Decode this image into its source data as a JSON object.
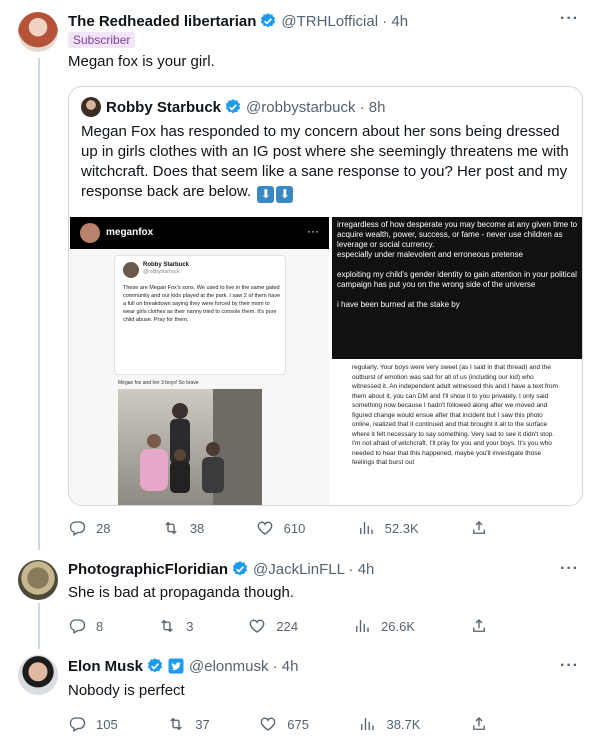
{
  "tweets": [
    {
      "name": "The Redheaded libertarian",
      "handle": "@TRHLofficial · 4h",
      "badge": "Subscriber",
      "text": "Megan fox is your girl.",
      "quote": {
        "name": "Robby Starbuck",
        "handle": "@robbystarbuck · 8h",
        "text": "Megan Fox has responded to my concern about her sons being dressed up in girls clothes with an IG post where she seemingly threatens me with witchcraft. Does that seem like a sane response to you? Her post and my response back are below.",
        "media": {
          "ig_name": "meganfox",
          "card_name": "Robby Starbuck",
          "card_handle": "@robbystarbuck",
          "card_text": "These are Megan Fox's sons. We used to live in the same gated community and our kids played at the park. I saw 2 of them have a full on breakdown saying they were forced by their mom to wear girls clothes as their nanny tried to console them. It's pure child abuse. Pray for them.",
          "caption": "Megan fox and her 3 boys! So brave",
          "dark_p1": "irregardless of how desperate you may become at any given time to acquire wealth, power, success, or fame - never use children as leverage or social currency.",
          "dark_p1b": "especially under malevolent and erroneous pretense",
          "dark_p2": "exploiting my child's gender identity to gain attention in your political campaign has put you on the wrong side of the universe",
          "dark_p3": "i have been burned at the stake by",
          "light_text": "regularly. Your boys were very sweet (as I said in that thread) and the outburst of emotion was sad for all of us (including our kid) who witnessed it. An independent adult witnessed this and I have a text from them about it, you can DM and I'll show it to you privately. I only said something now because I hadn't followed along after we moved and figured change would ensue after that incident but I saw this photo online, realized that it continued and that brought it all to the surface where it felt necessary to say something. Very sad to see it didn't stop. I'm not afraid of witchcraft. I'll pray for you and your boys. It's you who needed to hear that this happened, maybe you'll investigate those feelings that burst out"
        }
      },
      "stats": {
        "replies": "28",
        "retweets": "38",
        "likes": "610",
        "views": "52.3K"
      }
    },
    {
      "name": "PhotographicFloridian",
      "handle": "@JackLinFLL · 4h",
      "text": "She is bad at propaganda though.",
      "stats": {
        "replies": "8",
        "retweets": "3",
        "likes": "224",
        "views": "26.6K"
      }
    },
    {
      "name": "Elon Musk",
      "handle": "@elonmusk · 4h",
      "text": "Nobody is perfect",
      "stats": {
        "replies": "105",
        "retweets": "37",
        "likes": "675",
        "views": "38.7K"
      }
    }
  ],
  "icons": {
    "reply": "reply-icon",
    "retweet": "retweet-icon",
    "like": "like-icon",
    "views": "views-icon",
    "share": "share-icon",
    "verified": "verified-badge-icon",
    "more": "more-icon"
  },
  "colors": {
    "verified": "#1d9bf0",
    "secondary_text": "#536471",
    "border": "#cfd9de",
    "badge_bg": "#f1e5f7",
    "badge_text": "#7a3ea0"
  }
}
